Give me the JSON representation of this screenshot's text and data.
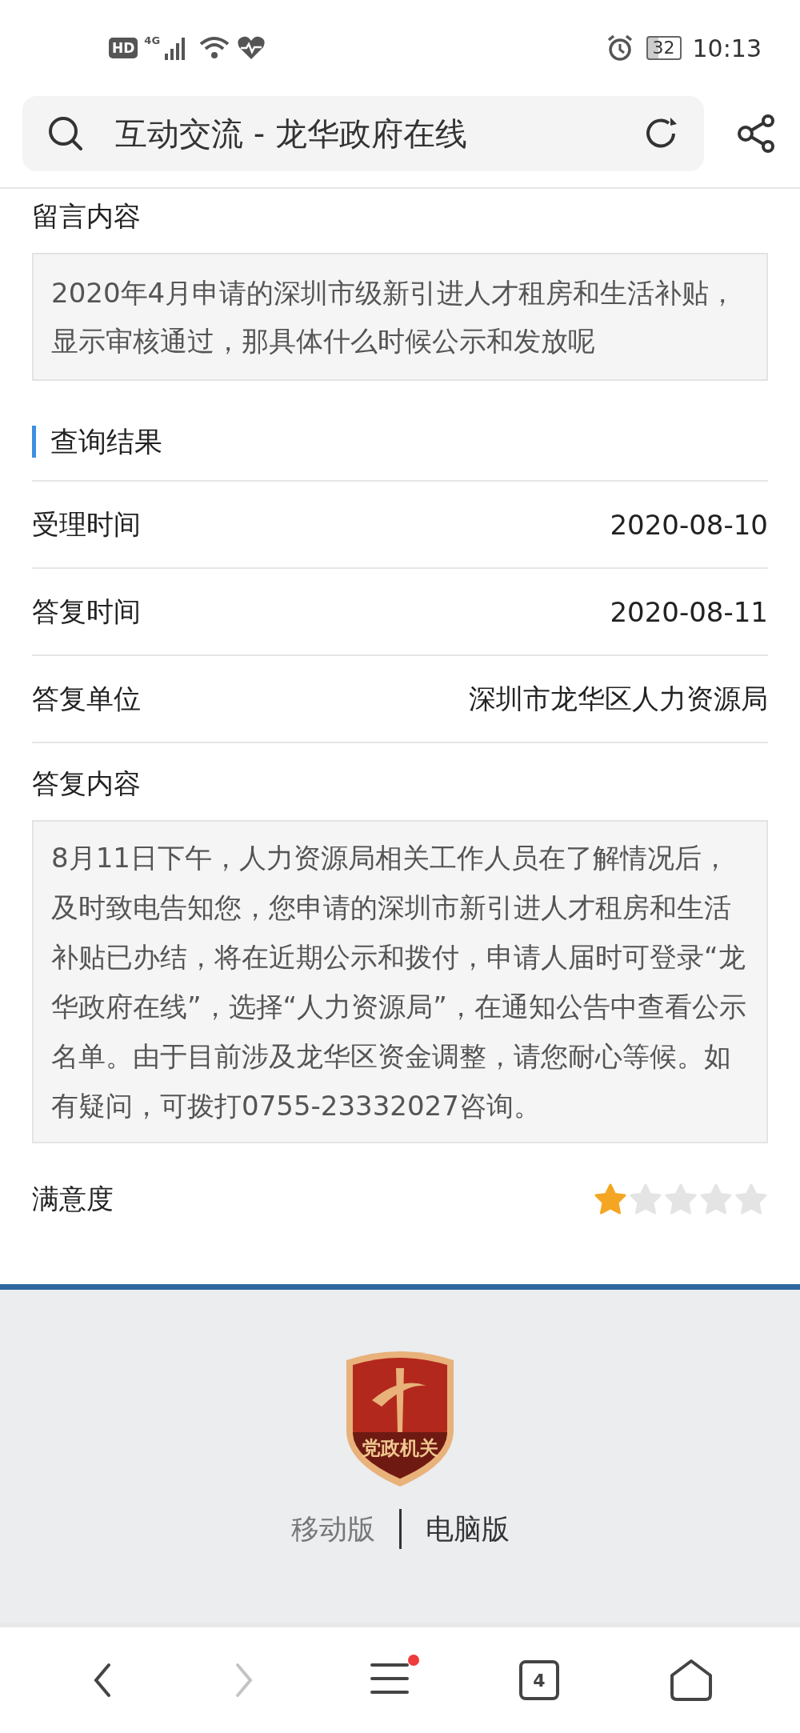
{
  "status_bar": {
    "hd": "HD",
    "network": "4G",
    "battery": "32",
    "time": "10:13"
  },
  "address_bar": {
    "title": "互动交流 - 龙华政府在线"
  },
  "message": {
    "label": "留言内容",
    "content": "2020年4月申请的深圳市级新引进人才租房和生活补贴，显示审核通过，那具体什么时候公示和发放呢"
  },
  "result": {
    "heading": "查询结果",
    "rows": [
      {
        "label": "受理时间",
        "value": "2020-08-10"
      },
      {
        "label": "答复时间",
        "value": "2020-08-11"
      },
      {
        "label": "答复单位",
        "value": "深圳市龙华区人力资源局"
      }
    ],
    "reply_label": "答复内容",
    "reply": "8月11日下午，人力资源局相关工作人员在了解情况后，及时致电告知您，您申请的深圳市新引进人才租房和生活补贴已办结，将在近期公示和拨付，申请人届时可登录“龙华政府在线”，选择“人力资源局”，在通知公告中查看公示名单。由于目前涉及龙华区资金调整，请您耐心等候。如有疑问，可拨打0755-23332027咨询。",
    "satisfaction_label": "满意度",
    "stars": 1
  },
  "footer": {
    "badge_text": "党政机关",
    "links": [
      {
        "label": "移动版",
        "selected": false
      },
      {
        "label": "电脑版",
        "selected": true
      }
    ]
  },
  "nav": {
    "tabs_count": "4",
    "menu_badge": true
  }
}
